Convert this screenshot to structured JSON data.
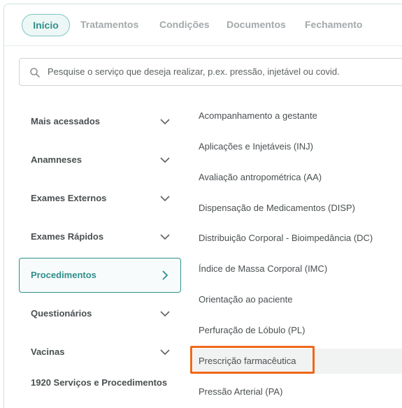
{
  "tabs": [
    {
      "label": "Início",
      "active": true
    },
    {
      "label": "Tratamentos"
    },
    {
      "label": "Condições"
    },
    {
      "label": "Documentos"
    },
    {
      "label": "Fechamento"
    }
  ],
  "search": {
    "placeholder": "Pesquise o serviço que deseja realizar, p.ex. pressão, injetável ou covid.",
    "icon": "search-icon"
  },
  "categories": [
    {
      "label": "Mais acessados",
      "icon": "chevron-down-icon"
    },
    {
      "label": "Anamneses",
      "icon": "chevron-down-icon"
    },
    {
      "label": "Exames Externos",
      "icon": "chevron-down-icon"
    },
    {
      "label": "Exames Rápidos",
      "icon": "chevron-down-icon"
    },
    {
      "label": "Procedimentos",
      "icon": "chevron-right-icon",
      "active": true
    },
    {
      "label": "Questionários",
      "icon": "chevron-down-icon"
    },
    {
      "label": "Vacinas",
      "icon": "chevron-down-icon"
    }
  ],
  "footer": {
    "count_label": "1920 Serviços e Procedimentos"
  },
  "procedures": [
    "Acompanhamento a gestante",
    "Aplicações e Injetáveis (INJ)",
    "Avaliação antropométrica (AA)",
    "Dispensação de Medicamentos (DISP)",
    "Distribuição Corporal - Bioimpedância (DC)",
    "Índice de Massa Corporal (IMC)",
    "Orientação ao paciente",
    "Perfuração de Lóbulo (PL)",
    "Prescrição farmacêutica",
    "Pressão Arterial (PA)"
  ],
  "highlighted_procedure": "Prescrição farmacêutica",
  "colors": {
    "accent": "#2f8f8b",
    "highlight": "#f06818"
  }
}
